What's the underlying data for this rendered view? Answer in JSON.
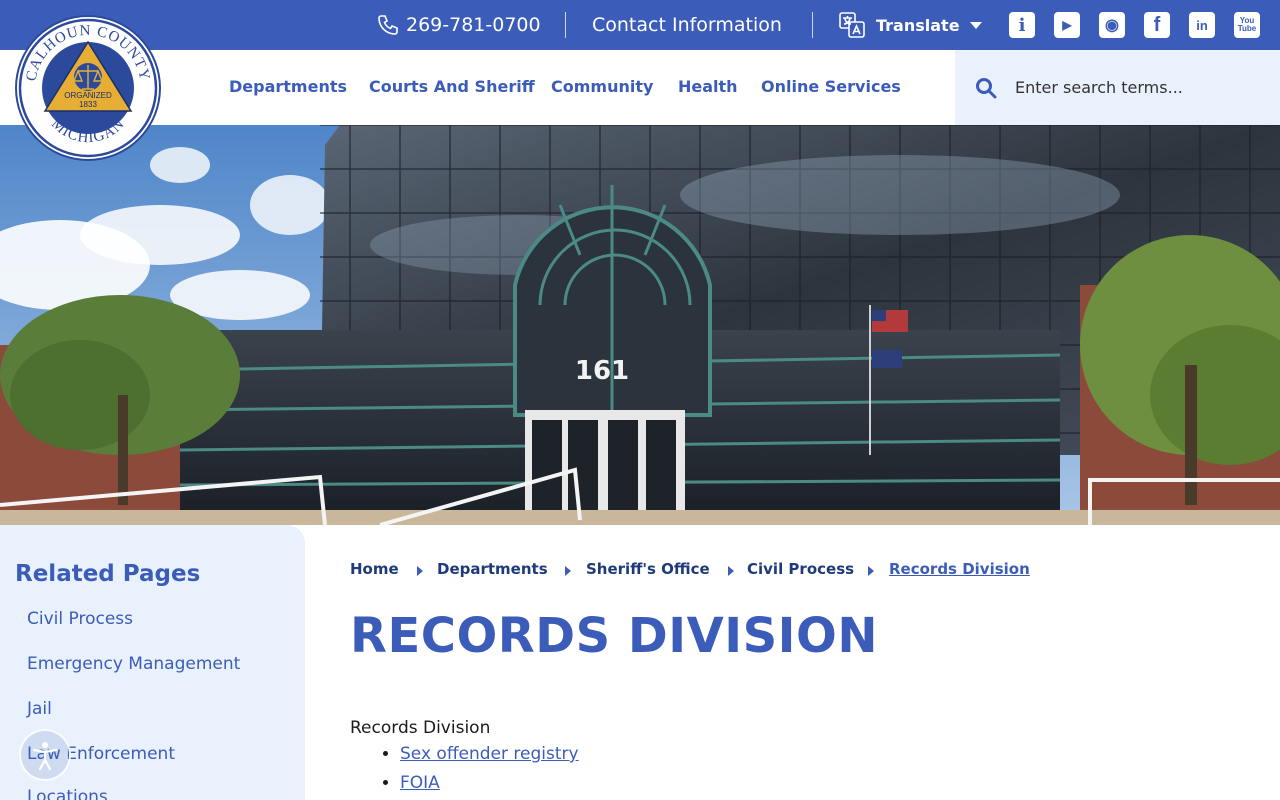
{
  "topbar": {
    "phone": "269-781-0700",
    "contact_label": "Contact Information",
    "translate_label": "Translate",
    "social": [
      {
        "name": "info-icon",
        "glyph": "i"
      },
      {
        "name": "youtube-play-icon",
        "glyph": "▶"
      },
      {
        "name": "podcast-icon",
        "glyph": "◉"
      },
      {
        "name": "facebook-icon",
        "glyph": "f"
      },
      {
        "name": "linkedin-icon",
        "glyph": "in"
      },
      {
        "name": "youtube-icon",
        "glyph": "You Tube"
      }
    ]
  },
  "logo": {
    "top_text": "CALHOUN COUNTY",
    "bottom_text": "MICHIGAN",
    "organized": "ORGANIZED",
    "year": "1833"
  },
  "nav": {
    "items": [
      "Departments",
      "Courts And Sheriff",
      "Community",
      "Health",
      "Online Services"
    ]
  },
  "search": {
    "placeholder": "Enter search terms..."
  },
  "hero": {
    "building_number": "161"
  },
  "sidebar": {
    "heading": "Related Pages",
    "links": [
      "Civil Process",
      "Emergency Management",
      "Jail",
      "Law Enforcement",
      "Locations"
    ]
  },
  "breadcrumb": {
    "items": [
      "Home",
      "Departments",
      "Sheriff's Office",
      "Civil Process",
      "Records Division"
    ]
  },
  "page": {
    "title": "RECORDS DIVISION",
    "body_label": "Records Division",
    "links": [
      "Sex offender registry",
      "FOIA"
    ]
  },
  "colors": {
    "brand_blue": "#3b5cb8",
    "sidebar_bg": "#e9f1fc",
    "breadcrumb_text": "#1f3a7a",
    "logo_gold": "#e6ae34"
  }
}
